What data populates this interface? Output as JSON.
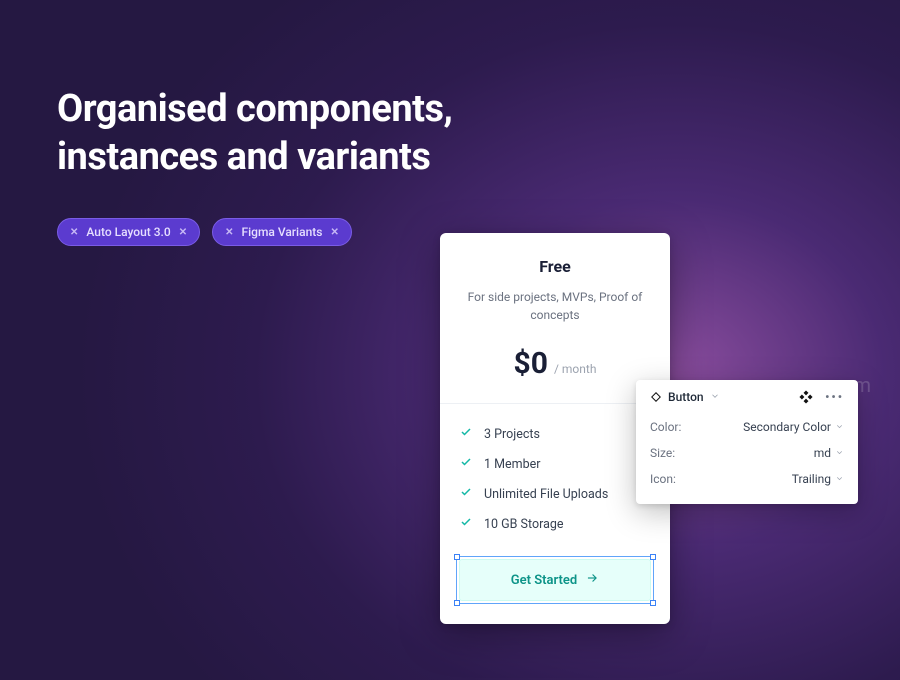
{
  "heading_line1": "Organised components,",
  "heading_line2": "instances and variants",
  "pills": [
    {
      "label": "Auto Layout 3.0"
    },
    {
      "label": "Figma Variants"
    }
  ],
  "card": {
    "plan_name": "Free",
    "description": "For side projects, MVPs, Proof of concepts",
    "price": "$0",
    "period": "/ month",
    "features": [
      "3 Projects",
      "1 Member",
      "Unlimited File Uploads",
      "10 GB Storage"
    ],
    "cta_label": "Get Started"
  },
  "inspector": {
    "component_name": "Button",
    "rows": [
      {
        "label": "Color:",
        "value": "Secondary Color"
      },
      {
        "label": "Size:",
        "value": "md"
      },
      {
        "label": "Icon:",
        "value": "Trailing"
      }
    ]
  },
  "watermark": "m"
}
